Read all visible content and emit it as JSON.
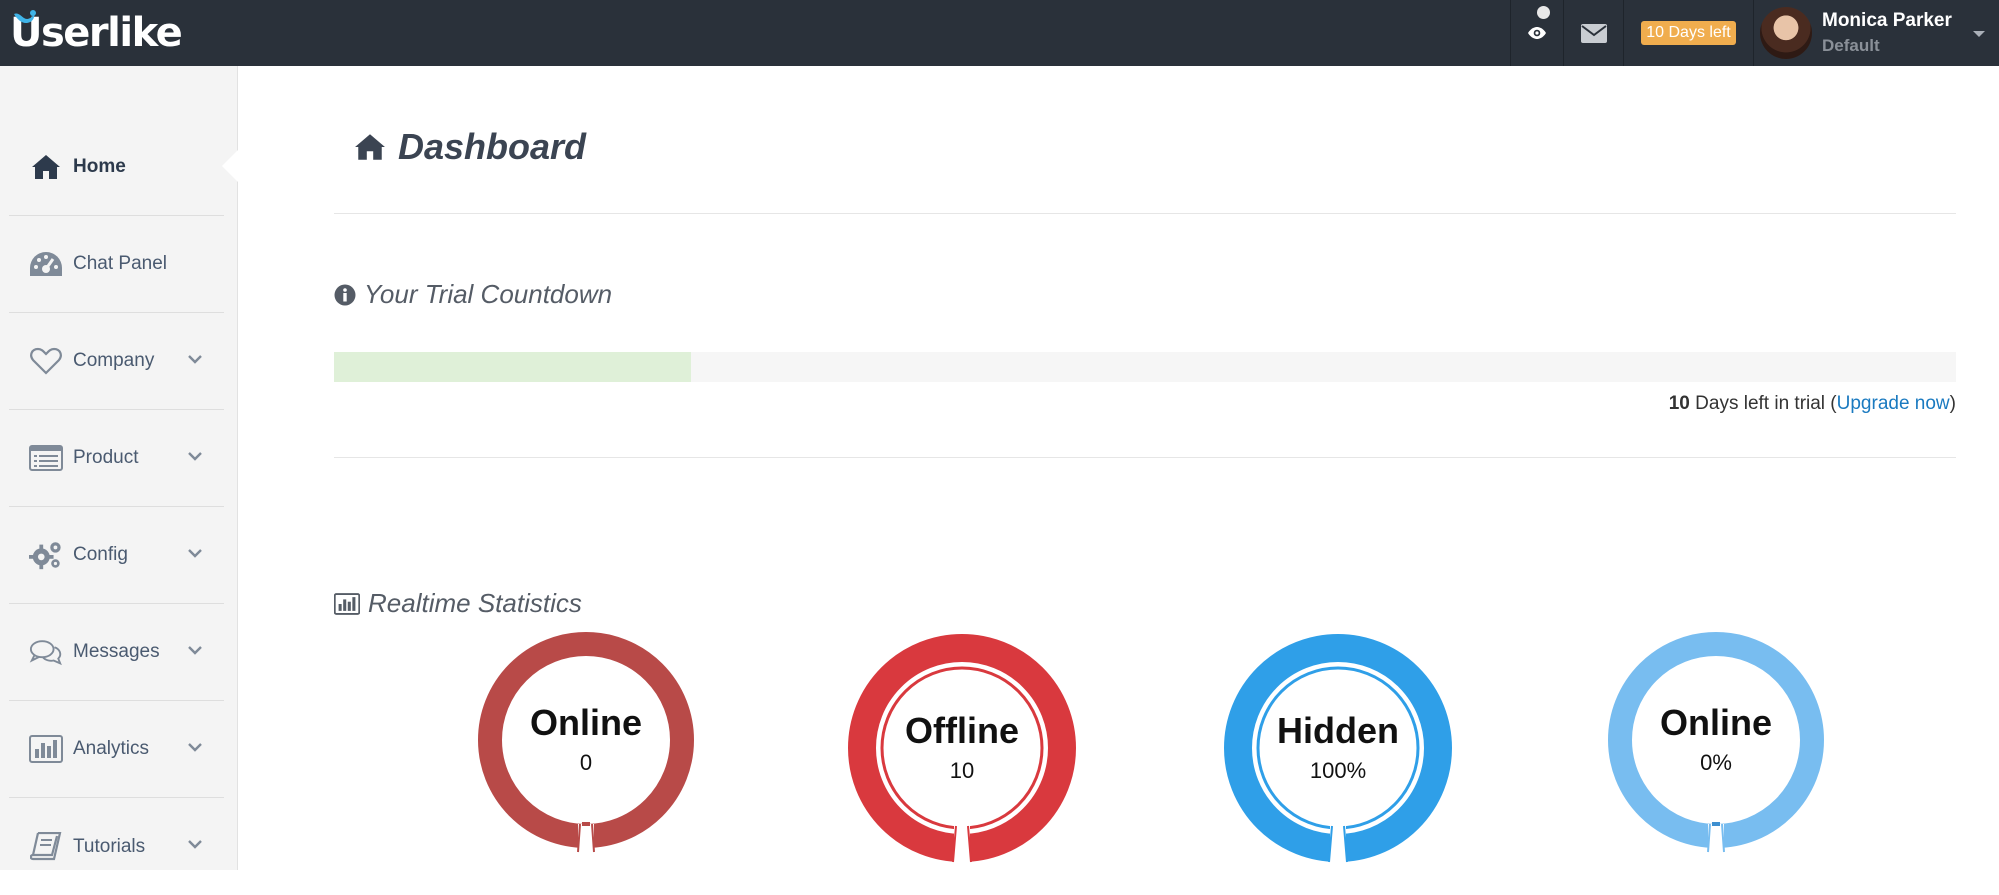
{
  "app": {
    "logo_text": "Userlike"
  },
  "topbar": {
    "trial_badge": "10 Days left",
    "user_name": "Monica Parker",
    "user_role": "Default"
  },
  "sidebar": {
    "items": [
      {
        "label": "Home",
        "icon": "home-icon",
        "active": true
      },
      {
        "label": "Chat Panel",
        "icon": "dashboard-gauge-icon"
      },
      {
        "label": "Company",
        "icon": "heart-icon"
      },
      {
        "label": "Product",
        "icon": "list-icon"
      },
      {
        "label": "Config",
        "icon": "gears-icon"
      },
      {
        "label": "Messages",
        "icon": "comments-icon"
      },
      {
        "label": "Analytics",
        "icon": "bar-chart-icon"
      },
      {
        "label": "Tutorials",
        "icon": "book-icon"
      }
    ]
  },
  "main": {
    "title": "Dashboard",
    "trial_section_title": "Your Trial Countdown",
    "trial_progress_fraction": 0.22,
    "trial_days": "10",
    "trial_days_text": " Days left in trial (",
    "upgrade_link": "Upgrade now",
    "trial_close": ")",
    "stats_section_title": "Realtime Statistics",
    "gauges": [
      {
        "label": "Online",
        "value": "0",
        "color": "#b84a48"
      },
      {
        "label": "Offline",
        "value": "10",
        "color": "#d9393e"
      },
      {
        "label": "Hidden",
        "value": "100%",
        "color": "#2f9fe8"
      },
      {
        "label": "Online",
        "value": "0%",
        "color": "#78bdf0"
      }
    ]
  },
  "colors": {
    "topbar_bg": "#2a313a",
    "badge_orange": "#f0ad4e",
    "link_blue": "#1a7ac0",
    "progress_green": "#dff0d8"
  }
}
